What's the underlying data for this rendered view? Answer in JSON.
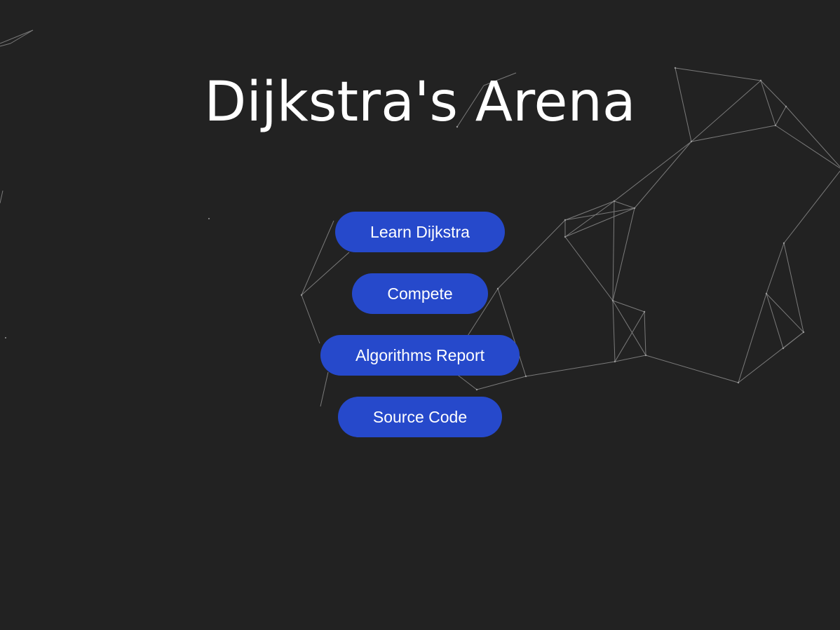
{
  "title": "Dijkstra's Arena",
  "menu": {
    "buttons": [
      {
        "id": "learn",
        "label": "Learn Dijkstra"
      },
      {
        "id": "compete",
        "label": "Compete"
      },
      {
        "id": "report",
        "label": "Algorithms Report"
      },
      {
        "id": "source",
        "label": "Source Code"
      }
    ]
  },
  "colors": {
    "background": "#222222",
    "button": "#2649cb",
    "text": "#ffffff",
    "network_lines": "#8a8a8a"
  },
  "decor": {
    "background_pattern": "network-lines"
  }
}
